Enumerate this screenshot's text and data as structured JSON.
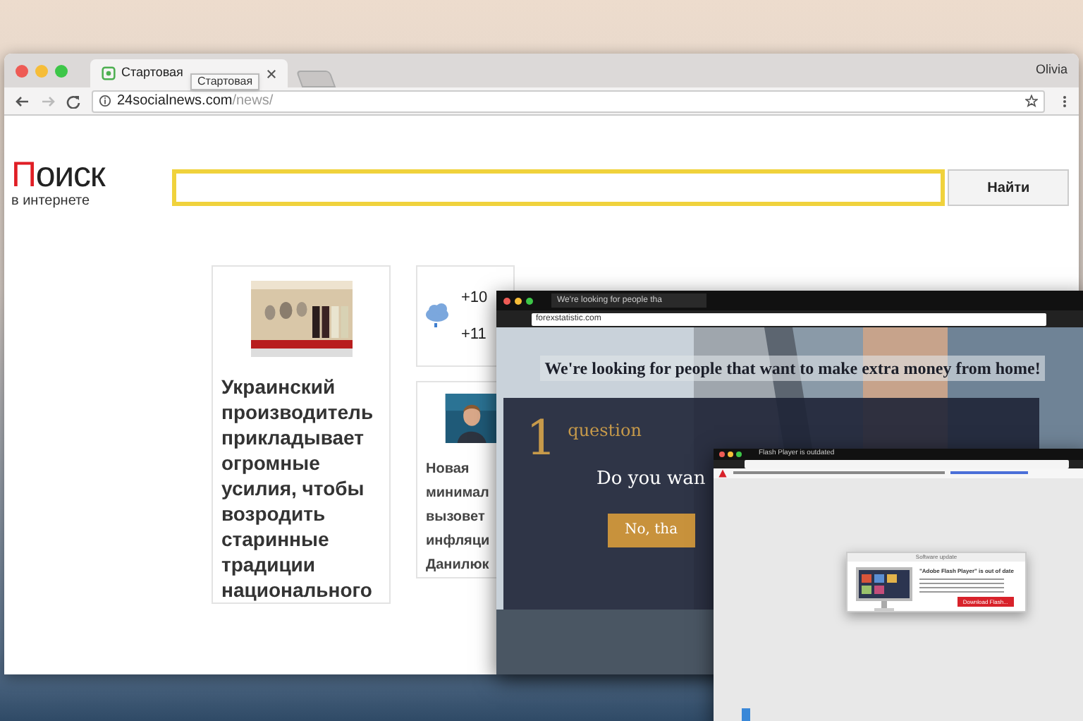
{
  "browser": {
    "profile": "Olivia",
    "tabs": [
      {
        "title": "Стартовая",
        "selected": true
      }
    ],
    "tooltip": "Стартовая",
    "url": {
      "host": "24socialnews.com",
      "path": "/news/"
    }
  },
  "page": {
    "logo": {
      "initial": "П",
      "rest": "оиск",
      "tagline": "в интернете"
    },
    "search": {
      "button": "Найти"
    },
    "cards": [
      {
        "kind": "article",
        "headline": "Украинский производитель прикладывает огромные усилия, чтобы возродить старинные традиции национального"
      },
      {
        "kind": "weather",
        "temps": [
          "+10",
          "+11"
        ]
      },
      {
        "kind": "photo-article",
        "lines": [
          "Новая",
          "минимал",
          "вызовет",
          "инфляци",
          "Данилюк"
        ]
      }
    ]
  },
  "popup_windows": [
    {
      "kind": "survey",
      "tab": "We're looking for people tha",
      "url": "forexstatistic.com",
      "headline": "We're looking for people that want to make extra money from home!",
      "number": "1",
      "label": "question",
      "question": "Do you wan",
      "button": "No, tha"
    },
    {
      "kind": "flash",
      "tab": "Flash Player is outdated",
      "dialog_title": "Software update",
      "dialog_heading": "\"Adobe Flash Player\" is out of date",
      "button": "Download Flash..."
    }
  ]
}
